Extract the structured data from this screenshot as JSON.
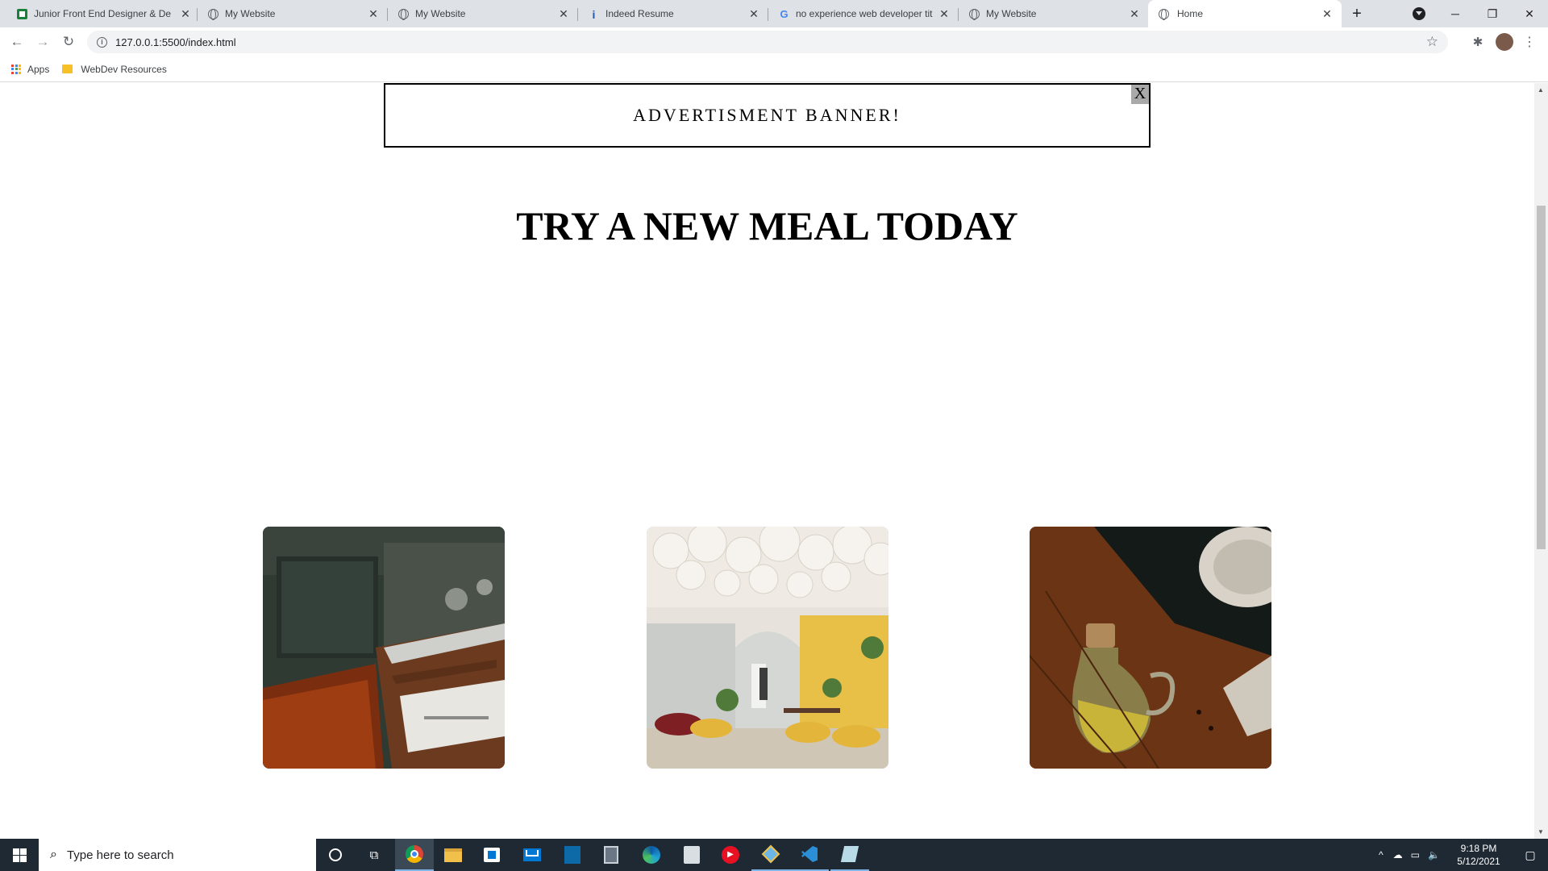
{
  "browser": {
    "tabs": [
      {
        "title": "Junior Front End Designer & De",
        "favicon": "green-sheet-icon",
        "active": false
      },
      {
        "title": "My Website",
        "favicon": "globe-icon",
        "active": false
      },
      {
        "title": "My Website",
        "favicon": "globe-icon",
        "active": false
      },
      {
        "title": "Indeed Resume",
        "favicon": "indeed-icon",
        "active": false
      },
      {
        "title": "no experience web developer tit",
        "favicon": "google-icon",
        "active": false
      },
      {
        "title": "My Website",
        "favicon": "globe-icon",
        "active": false
      },
      {
        "title": "Home",
        "favicon": "globe-icon",
        "active": true
      }
    ],
    "new_tab_label": "+",
    "url": "127.0.0.1:5500/index.html",
    "bookmarks": [
      {
        "label": "Apps",
        "icon": "apps-grid-icon"
      },
      {
        "label": "WebDev Resources",
        "icon": "folder-icon"
      }
    ]
  },
  "page": {
    "banner_text": "ADVERTISMENT BANNER!",
    "banner_close": "X",
    "headline": "TRY A NEW MEAL TODAY",
    "photos": [
      {
        "name": "restaurant-booths-photo"
      },
      {
        "name": "yellow-dining-room-photo"
      },
      {
        "name": "olive-oil-jug-photo"
      }
    ]
  },
  "taskbar": {
    "search_placeholder": "Type here to search",
    "time": "9:18 PM",
    "date": "5/12/2021"
  },
  "colors": {
    "tabstrip": "#dee1e6",
    "taskbar": "#1f2933",
    "accent_blue": "#0078d4"
  }
}
